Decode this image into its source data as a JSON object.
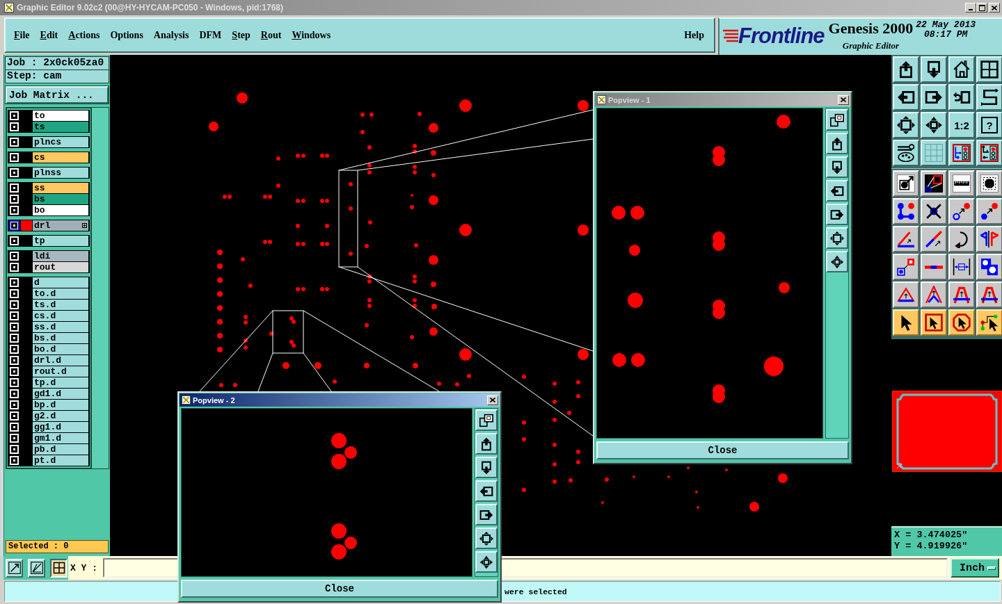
{
  "title_bar": {
    "title": "Graphic Editor 9.02c2 (00@HY-HYCAM-PC050 - Windows, pid:1768)"
  },
  "menu": [
    {
      "label": "File",
      "mnemonic": true
    },
    {
      "label": "Edit",
      "mnemonic": true
    },
    {
      "label": "Actions",
      "mnemonic": true
    },
    {
      "label": "Options",
      "mnemonic": false
    },
    {
      "label": "Analysis",
      "mnemonic": false
    },
    {
      "label": "DFM",
      "mnemonic": false
    },
    {
      "label": "Step",
      "mnemonic": true
    },
    {
      "label": "Rout",
      "mnemonic": true
    },
    {
      "label": "Windows",
      "mnemonic": true
    }
  ],
  "help_menu": {
    "label": "Help",
    "mnemonic": false
  },
  "brand": {
    "logo": "Frontline",
    "product": "Genesis 2000",
    "subtitle": "Graphic Editor",
    "date": "22 May 2013",
    "time": "08:17 PM"
  },
  "job": {
    "job": "Job : 2x0ck05za0",
    "step": "Step: cam",
    "matrix_button": "Job Matrix ..."
  },
  "layer_groups": [
    {
      "layers": [
        {
          "name": "to",
          "color": "#ffffff",
          "checked": true,
          "affected": false
        },
        {
          "name": "ts",
          "color": "#1fa584",
          "checked": true,
          "affected": false
        }
      ]
    },
    {
      "layers": [
        {
          "name": "plncs",
          "color": "#a0dcdc",
          "checked": true,
          "affected": false
        }
      ]
    },
    {
      "layers": [
        {
          "name": "cs",
          "color": "#ffc860",
          "checked": true,
          "affected": false
        }
      ]
    },
    {
      "layers": [
        {
          "name": "plnss",
          "color": "#a0dcdc",
          "checked": true,
          "affected": false
        }
      ]
    },
    {
      "layers": [
        {
          "name": "ss",
          "color": "#ffc860",
          "checked": true,
          "affected": false
        },
        {
          "name": "bs",
          "color": "#1fa584",
          "checked": true,
          "affected": false
        },
        {
          "name": "bo",
          "color": "#ffffff",
          "checked": true,
          "affected": false
        }
      ]
    },
    {
      "layers": [
        {
          "name": "drl",
          "color": "#a0b0b8",
          "checked": true,
          "affected": true,
          "display": {
            "color": "#ff0000"
          }
        }
      ]
    },
    {
      "layers": [
        {
          "name": "tp",
          "color": "#a0dcdc",
          "checked": true,
          "affected": false
        }
      ]
    },
    {
      "layers": [
        {
          "name": "ldi",
          "color": "#a8b8c0",
          "checked": true,
          "affected": false
        },
        {
          "name": "rout",
          "color": "#d8d8d8",
          "checked": true,
          "affected": false
        }
      ]
    },
    {
      "layers": [
        {
          "name": "d",
          "color": "#a0dcdc",
          "checked": true,
          "affected": false
        },
        {
          "name": "to.d",
          "color": "#a0dcdc",
          "checked": true,
          "affected": false
        },
        {
          "name": "ts.d",
          "color": "#a0dcdc",
          "checked": true,
          "affected": false
        },
        {
          "name": "cs.d",
          "color": "#a0dcdc",
          "checked": true,
          "affected": false
        },
        {
          "name": "ss.d",
          "color": "#a0dcdc",
          "checked": true,
          "affected": false
        },
        {
          "name": "bs.d",
          "color": "#a0dcdc",
          "checked": true,
          "affected": false
        },
        {
          "name": "bo.d",
          "color": "#a0dcdc",
          "checked": true,
          "affected": false
        },
        {
          "name": "drl.d",
          "color": "#a0dcdc",
          "checked": true,
          "affected": false
        },
        {
          "name": "rout.d",
          "color": "#a0dcdc",
          "checked": true,
          "affected": false
        },
        {
          "name": "tp.d",
          "color": "#a0dcdc",
          "checked": true,
          "affected": false
        },
        {
          "name": "gd1.d",
          "color": "#a0dcdc",
          "checked": true,
          "affected": false
        },
        {
          "name": "bp.d",
          "color": "#a0dcdc",
          "checked": true,
          "affected": false
        },
        {
          "name": "g2.d",
          "color": "#a0dcdc",
          "checked": true,
          "affected": false
        },
        {
          "name": "gg1.d",
          "color": "#a0dcdc",
          "checked": true,
          "affected": false
        },
        {
          "name": "gm1.d",
          "color": "#a0dcdc",
          "checked": true,
          "affected": false
        },
        {
          "name": "pb.d",
          "color": "#a0dcdc",
          "checked": true,
          "affected": false
        },
        {
          "name": "pt.d",
          "color": "#a0dcdc",
          "checked": true,
          "affected": false
        }
      ]
    }
  ],
  "selected": "Selected : 0",
  "right_toolbar": {
    "scale": "1:2",
    "help": "?"
  },
  "coordinates": {
    "x": "X = 3.474025\"",
    "y": "Y = 4.919926\""
  },
  "popviews": [
    {
      "title": "Popview - 1",
      "active": false,
      "close": "Close"
    },
    {
      "title": "Popview - 2",
      "active": true,
      "close": "Close"
    }
  ],
  "command_bar": {
    "tools": [
      {
        "on": false
      },
      {
        "on": false
      },
      {
        "on": true
      }
    ],
    "label": "X Y :",
    "units": "Inch"
  },
  "status_bar": {
    "message": "were selected"
  }
}
